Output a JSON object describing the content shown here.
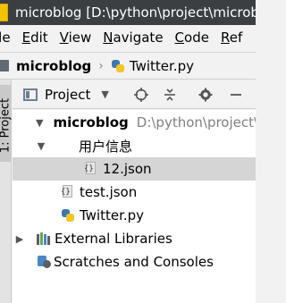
{
  "window": {
    "title": "microblog [D:\\python\\project\\microb"
  },
  "menu": [
    {
      "label": "File",
      "underline": "F",
      "rest": "ile",
      "visible_start": "ile"
    },
    {
      "label": "Edit",
      "underline": "E",
      "rest": "dit"
    },
    {
      "label": "View",
      "underline": "V",
      "rest": "iew"
    },
    {
      "label": "Navigate",
      "underline": "N",
      "rest": "avigate"
    },
    {
      "label": "Code",
      "underline": "C",
      "rest": "ode"
    },
    {
      "label": "Ref",
      "underline": "R",
      "rest": "ef"
    }
  ],
  "breadcrumb": {
    "folder": "microblog",
    "separator": "›",
    "file": "Twitter.py"
  },
  "side_tab": {
    "label": "1: Project"
  },
  "panel": {
    "title": "Project",
    "dropdown_icon": "▼"
  },
  "tree": [
    {
      "label": "microblog",
      "path": "D:\\python\\project\\",
      "level": 0,
      "expanded": true,
      "type": "project-folder"
    },
    {
      "label": "用户信息",
      "level": 1,
      "expanded": true,
      "type": "folder"
    },
    {
      "label": "12.json",
      "level": 2,
      "type": "json",
      "selected": true
    },
    {
      "label": "test.json",
      "level": 1,
      "type": "json"
    },
    {
      "label": "Twitter.py",
      "level": 1,
      "type": "python"
    },
    {
      "label": "External Libraries",
      "level": 0,
      "expanded": false,
      "type": "libraries"
    },
    {
      "label": "Scratches and Consoles",
      "level": 0,
      "type": "scratches"
    }
  ],
  "colors": {
    "titlebar": "#3c3f41",
    "selection": "#d5d5d5",
    "python_blue": "#3b77b1",
    "python_yellow": "#f3c624"
  }
}
